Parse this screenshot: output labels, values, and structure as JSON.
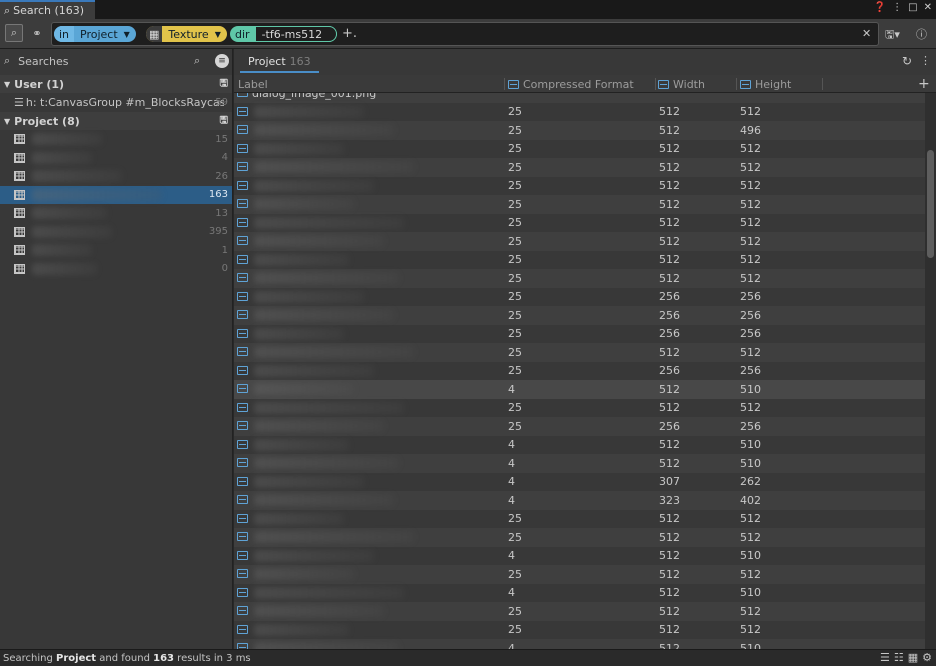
{
  "window": {
    "tab_title": "Search (163)",
    "tab_icon": "magnifier-icon"
  },
  "query": {
    "chips": [
      {
        "key": "in",
        "value": "Project",
        "color": "#5aa6d6"
      },
      {
        "key": "",
        "value": "Texture",
        "color": "#e1c34a"
      },
      {
        "key": "dir",
        "value": "-tf6-ms512",
        "color": "#5fc7a8"
      }
    ],
    "add_label": "+."
  },
  "left": {
    "header": "Searches",
    "groups": [
      {
        "title": "User (1)",
        "items": [
          {
            "label": "h: t:CanvasGroup #m_BlocksRaycasts",
            "count": "59"
          }
        ]
      },
      {
        "title": "Project (8)",
        "counts": [
          "15",
          "4",
          "26",
          "163",
          "13",
          "395",
          "1",
          "0"
        ],
        "selected_index": 3
      }
    ]
  },
  "right": {
    "tab_label": "Project",
    "tab_count": "163",
    "columns": [
      "Label",
      "Compressed Format",
      "Width",
      "Height"
    ],
    "top_partial_label": "dialog_image_001.png",
    "bottom_partial_label": "icon_normal_bc_000_0.png",
    "rows": [
      [
        "25",
        "512",
        "512"
      ],
      [
        "25",
        "512",
        "496"
      ],
      [
        "25",
        "512",
        "512"
      ],
      [
        "25",
        "512",
        "512"
      ],
      [
        "25",
        "512",
        "512"
      ],
      [
        "25",
        "512",
        "512"
      ],
      [
        "25",
        "512",
        "512"
      ],
      [
        "25",
        "512",
        "512"
      ],
      [
        "25",
        "512",
        "512"
      ],
      [
        "25",
        "512",
        "512"
      ],
      [
        "25",
        "256",
        "256"
      ],
      [
        "25",
        "256",
        "256"
      ],
      [
        "25",
        "256",
        "256"
      ],
      [
        "25",
        "512",
        "512"
      ],
      [
        "25",
        "256",
        "256"
      ],
      [
        "4",
        "512",
        "510"
      ],
      [
        "25",
        "512",
        "512"
      ],
      [
        "25",
        "256",
        "256"
      ],
      [
        "4",
        "512",
        "510"
      ],
      [
        "4",
        "512",
        "510"
      ],
      [
        "4",
        "307",
        "262"
      ],
      [
        "4",
        "323",
        "402"
      ],
      [
        "25",
        "512",
        "512"
      ],
      [
        "25",
        "512",
        "512"
      ],
      [
        "4",
        "512",
        "510"
      ],
      [
        "25",
        "512",
        "512"
      ],
      [
        "4",
        "512",
        "510"
      ],
      [
        "25",
        "512",
        "512"
      ],
      [
        "25",
        "512",
        "512"
      ],
      [
        "4",
        "512",
        "510"
      ]
    ],
    "highlight_index": 15
  },
  "status": {
    "prefix": "Searching",
    "scope": "Project",
    "middle": "and found",
    "count": "163",
    "suffix": "results in 3 ms"
  }
}
